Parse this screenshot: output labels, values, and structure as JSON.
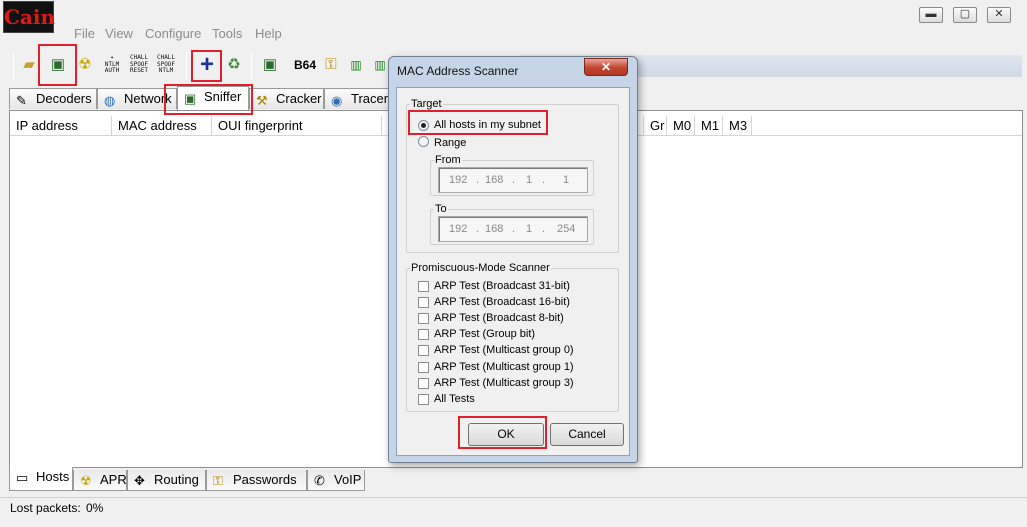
{
  "menu": [
    "File",
    "View",
    "Configure",
    "Tools",
    "Help"
  ],
  "window_controls": {
    "minimize": "▬",
    "maximize": "▢",
    "close": "✕"
  },
  "toolbar": {
    "ntlm_auth": "NTLM\nAUTH",
    "chall_spoof_reset": "CHALL\nSPOOF\nRESET",
    "chall_spoof_ntlm": "CHALL\nSPOOF\nNTLM",
    "add": "+",
    "b64": "B64"
  },
  "tabs": [
    {
      "label": "Decoders",
      "icon": "decoders-icon"
    },
    {
      "label": "Network",
      "icon": "network-icon"
    },
    {
      "label": "Sniffer",
      "icon": "sniffer-icon",
      "active": true
    },
    {
      "label": "Cracker",
      "icon": "cracker-icon"
    },
    {
      "label": "Tracer",
      "icon": "tracer-icon"
    }
  ],
  "table": {
    "columns": [
      "IP address",
      "MAC address",
      "OUI fingerprint",
      "Gr",
      "M0",
      "M1",
      "M3"
    ],
    "rows": []
  },
  "bottom_tabs": [
    {
      "label": "Hosts",
      "active": true
    },
    {
      "label": "APR"
    },
    {
      "label": "Routing"
    },
    {
      "label": "Passwords"
    },
    {
      "label": "VoIP"
    }
  ],
  "status": {
    "label": "Lost packets:",
    "value": "0%"
  },
  "dialog": {
    "title": "MAC Address Scanner",
    "close": "✕",
    "target_label": "Target",
    "opt_subnet": "All hosts in my subnet",
    "opt_range": "Range",
    "selected": "subnet",
    "from_label": "From",
    "from_ip": [
      "192",
      "168",
      "1",
      "1"
    ],
    "to_label": "To",
    "to_ip": [
      "192",
      "168",
      "1",
      "254"
    ],
    "promisc_label": "Promiscuous-Mode Scanner",
    "tests": [
      "ARP Test (Broadcast 31-bit)",
      "ARP Test (Broadcast 16-bit)",
      "ARP Test (Broadcast 8-bit)",
      "ARP Test (Group bit)",
      "ARP Test (Multicast group 0)",
      "ARP Test (Multicast group 1)",
      "ARP Test (Multicast group 3)",
      "All Tests"
    ],
    "ok": "OK",
    "cancel": "Cancel"
  }
}
